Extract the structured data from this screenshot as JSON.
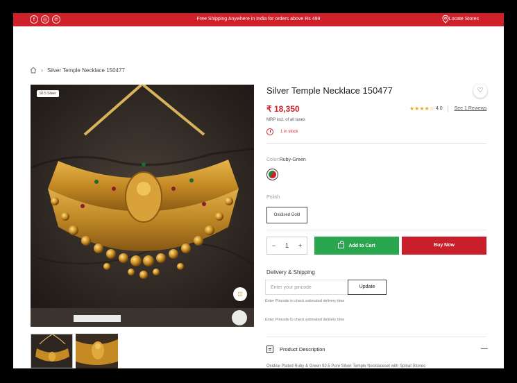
{
  "topbar": {
    "social": [
      "f",
      "◎",
      "℗"
    ],
    "promo": "Free Shipping Anywhere in India for orders above Rs 499",
    "locate": "Locate Stores"
  },
  "breadcrumb": {
    "current": "Silver Temple Necklace 150477"
  },
  "gallery": {
    "badge": "92.5 Silver"
  },
  "product": {
    "title": "Silver Temple Necklace 150477",
    "price": "₹ 18,350",
    "rating_value": "4.0",
    "rating_stars": "★★★★",
    "rating_empty": "☆",
    "reviews": "See 1 Reviews",
    "mrp": "MRP incl. of all taxes",
    "stock": "1 in stock",
    "color_label": "Color:",
    "color_value": "Ruby-Green",
    "polish_label": "Polish",
    "polish_option": "Oxidised Gold",
    "quantity": "1",
    "add_to_cart": "Add to Cart",
    "buy_now": "Buy Now"
  },
  "shipping": {
    "label": "Delivery & Shipping",
    "placeholder": "Enter your pincode",
    "update": "Update",
    "hint1": "Enter Pincode to check estimated delivery time",
    "hint2": "Enter Pincode to check estimated delivery time"
  },
  "description": {
    "label": "Product Description",
    "text": "Oxidise Plated Ruby & Green 92.5 Pure Silver Temple Necklaceset with Spinal Stones"
  },
  "colors": {
    "accent": "#d0202a",
    "cart": "#2aa64f",
    "star": "#e8a622"
  }
}
